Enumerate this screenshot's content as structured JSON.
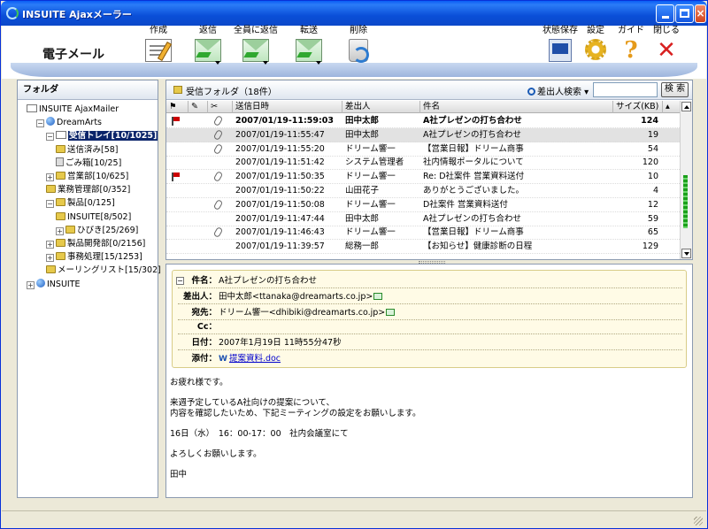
{
  "window": {
    "title": "INSUITE Ajaxメーラー"
  },
  "toolbar": {
    "app_name": "電子メール",
    "compose": "作成",
    "send": "返信",
    "reply_all": "全員に返信",
    "forward": "転送",
    "delete": "削除",
    "save_state": "状態保存",
    "settings": "設定",
    "guide": "ガイド",
    "close": "閉じる"
  },
  "folders": {
    "header": "フォルダ",
    "items": [
      {
        "label": "INSUITE AjaxMailer",
        "indent": 0,
        "icon": "mailbox",
        "pm": ""
      },
      {
        "label": "DreamArts",
        "indent": 1,
        "icon": "globe",
        "pm": "−"
      },
      {
        "label": "受信トレイ[10/1025]",
        "indent": 2,
        "icon": "mailbox",
        "pm": "−",
        "selected": true
      },
      {
        "label": "送信済み[58]",
        "indent": 3,
        "icon": "fold",
        "pm": ""
      },
      {
        "label": "ごみ箱[10/25]",
        "indent": 3,
        "icon": "trash",
        "pm": ""
      },
      {
        "label": "営業部[10/625]",
        "indent": 2,
        "icon": "fold",
        "pm": "+"
      },
      {
        "label": "業務管理部[0/352]",
        "indent": 2,
        "icon": "fold",
        "pm": ""
      },
      {
        "label": "製品[0/125]",
        "indent": 2,
        "icon": "fold",
        "pm": "−"
      },
      {
        "label": "INSUITE[8/502]",
        "indent": 3,
        "icon": "fold",
        "pm": ""
      },
      {
        "label": "ひびき[25/269]",
        "indent": 3,
        "icon": "fold",
        "pm": "+"
      },
      {
        "label": "製品開発部[0/2156]",
        "indent": 2,
        "icon": "fold",
        "pm": "+"
      },
      {
        "label": "事務処理[15/1253]",
        "indent": 2,
        "icon": "fold",
        "pm": "+"
      },
      {
        "label": "メーリングリスト[15/302]",
        "indent": 2,
        "icon": "fold",
        "pm": ""
      },
      {
        "label": "INSUITE",
        "indent": 0,
        "icon": "globe",
        "pm": "+"
      }
    ]
  },
  "list": {
    "current_folder": "受信フォルダ（18件）",
    "search_label": "差出人検索",
    "search_value": "",
    "search_button": "検 索",
    "columns": {
      "date": "送信日時",
      "from": "差出人",
      "subject": "件名",
      "size": "サイズ(KB)"
    },
    "rows": [
      {
        "flag": true,
        "clip": true,
        "date": "2007/01/19-11:59:03",
        "from": "田中太郎",
        "subject": "A社プレゼンの打ち合わせ",
        "size": "124",
        "unread": true,
        "selected": false
      },
      {
        "flag": false,
        "clip": true,
        "date": "2007/01/19-11:55:47",
        "from": "田中太郎",
        "subject": "A社プレゼンの打ち合わせ",
        "size": "19",
        "unread": false,
        "selected": true
      },
      {
        "flag": false,
        "clip": true,
        "date": "2007/01/19-11:55:20",
        "from": "ドリーム響一",
        "subject": "【営業日報】ドリーム商事",
        "size": "54",
        "unread": false,
        "selected": false
      },
      {
        "flag": false,
        "clip": false,
        "date": "2007/01/19-11:51:42",
        "from": "システム管理者",
        "subject": "社内情報ポータルについて",
        "size": "120",
        "unread": false,
        "selected": false
      },
      {
        "flag": true,
        "clip": true,
        "date": "2007/01/19-11:50:35",
        "from": "ドリーム響一",
        "subject": "Re: D社案件 営業資料送付",
        "size": "10",
        "unread": false,
        "selected": false
      },
      {
        "flag": false,
        "clip": false,
        "date": "2007/01/19-11:50:22",
        "from": "山田花子",
        "subject": "ありがとうございました。",
        "size": "4",
        "unread": false,
        "selected": false
      },
      {
        "flag": false,
        "clip": true,
        "date": "2007/01/19-11:50:08",
        "from": "ドリーム響一",
        "subject": "D社案件 営業資料送付",
        "size": "12",
        "unread": false,
        "selected": false
      },
      {
        "flag": false,
        "clip": false,
        "date": "2007/01/19-11:47:44",
        "from": "田中太郎",
        "subject": "A社プレゼンの打ち合わせ",
        "size": "59",
        "unread": false,
        "selected": false
      },
      {
        "flag": false,
        "clip": true,
        "date": "2007/01/19-11:46:43",
        "from": "ドリーム響一",
        "subject": "【営業日報】ドリーム商事",
        "size": "65",
        "unread": false,
        "selected": false
      },
      {
        "flag": false,
        "clip": false,
        "date": "2007/01/19-11:39:57",
        "from": "総務一郎",
        "subject": "【お知らせ】健康診断の日程",
        "size": "129",
        "unread": false,
        "selected": false
      }
    ]
  },
  "preview": {
    "subject_key": "件名：",
    "subject": "A社プレゼンの打ち合わせ",
    "from_key": "差出人：",
    "from": "田中太郎<ttanaka@dreamarts.co.jp>",
    "to_key": "宛先：",
    "to": "ドリーム響一<dhibiki@dreamarts.co.jp>",
    "cc_key": "Cc：",
    "cc": "",
    "date_key": "日付：",
    "date": "2007年1月19日 11時55分47秒",
    "attach_key": "添付：",
    "attachment": "提案資料.doc",
    "body": [
      "お疲れ様です。",
      "",
      "来週予定しているA社向けの提案について、",
      "内容を確認したいため、下記ミーティングの設定をお願いします。",
      "",
      "16日（水）　16：00-17：00　社内会議室にて",
      "",
      "よろしくお願いします。",
      "",
      "田中"
    ]
  }
}
